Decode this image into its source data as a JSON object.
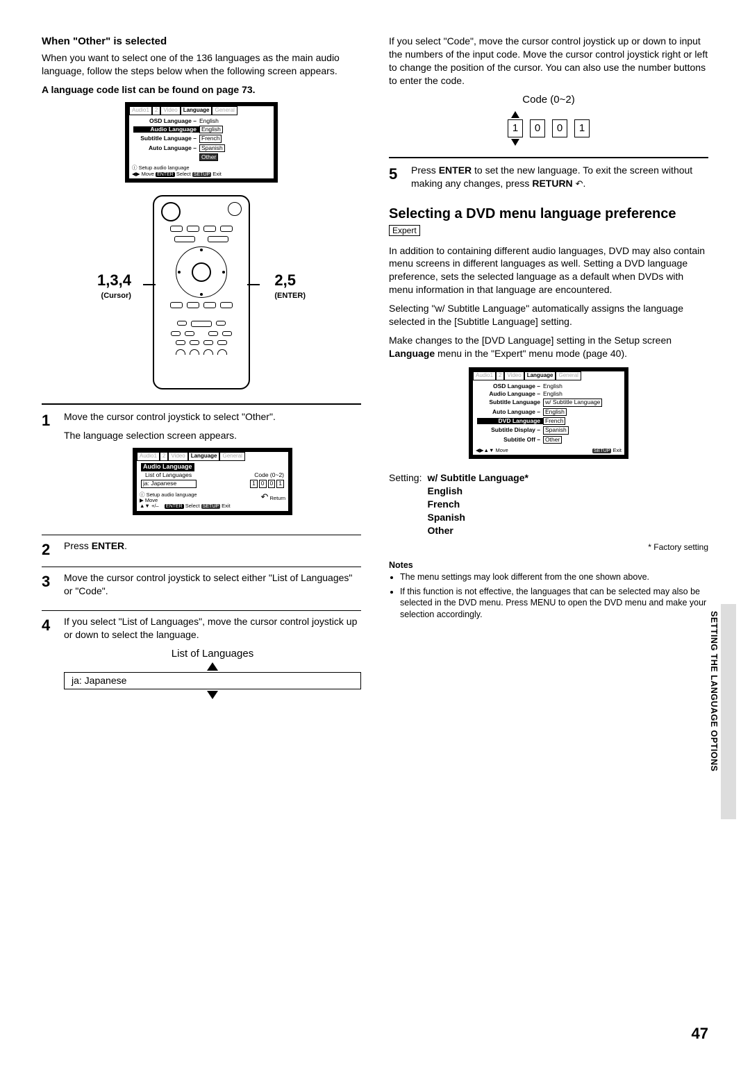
{
  "left": {
    "h_other": "When \"Other\" is selected",
    "p_other": "When you want to select one of the 136 languages as the main audio language, follow the steps below when the following screen appears.",
    "p_codelist": "A language code list can be found on page 73.",
    "screenshot1": {
      "tabs": [
        "Audio1",
        "2",
        "Video",
        "Language",
        "General"
      ],
      "rows": [
        {
          "lbl": "OSD Language –",
          "val": "English"
        },
        {
          "lbl": "Audio Language",
          "val": "English",
          "boxed": true,
          "hl": true
        },
        {
          "lbl": "Subtitle Language –",
          "val": "French",
          "boxed": true
        },
        {
          "lbl": "Auto Language –",
          "val": "Spanish",
          "boxed": true
        },
        {
          "lbl": "",
          "val": "Other",
          "boxed": true,
          "dark": true
        }
      ],
      "hint": "Setup audio language",
      "foot": [
        "Move",
        "ENTER",
        "Select",
        "SETUP",
        "Exit"
      ]
    },
    "callout_left_num": "1,3,4",
    "callout_left_sub": "(Cursor)",
    "callout_right_num": "2,5",
    "callout_right_sub": "(ENTER)",
    "step1_a": "Move the cursor control joystick to select \"Other\".",
    "step1_b": "The language selection screen appears.",
    "screenshot2": {
      "tabs": [
        "Audio1",
        "2",
        "Video",
        "Language",
        "General"
      ],
      "h": "Audio Language",
      "lol": "List of Languages",
      "code": "Code (0~2)",
      "field": "ja: Japanese",
      "digits": [
        "1",
        "0",
        "0",
        "1"
      ],
      "hint": "Setup audio language",
      "foot": [
        "Move",
        "+/–",
        "ENTER",
        "Select",
        "SETUP",
        "Exit",
        "Return"
      ]
    },
    "step2": "Press ",
    "step2_b": "ENTER",
    "step2_c": ".",
    "step3": "Move the cursor control joystick to select either \"List of Languages\" or \"Code\".",
    "step4": "If you select \"List of Languages\", move the cursor control joystick up or down to select the language.",
    "lol_title": "List of Languages",
    "lol_field": "ja: Japanese"
  },
  "right": {
    "p_code": "If you select \"Code\", move the cursor control joystick up or down to input the numbers of the input code. Move the cursor control joystick right or left to change the position of the cursor. You can also use the number buttons to enter the code.",
    "code_title": "Code (0~2)",
    "code_digits": [
      "1",
      "0",
      "0",
      "1"
    ],
    "step5_a": "Press ",
    "step5_b": "ENTER",
    "step5_c": " to set the new language. To exit the screen without making any changes, press ",
    "step5_d": "RETURN",
    "step5_e": " ",
    "h_section_a": "Selecting a DVD menu language preference",
    "expert": "Expert",
    "p_sec1": "In addition to containing different audio languages, DVD may also contain menu screens in different languages as well. Setting a DVD language preference, sets the selected language as a default when DVDs with menu information in that language are encountered.",
    "p_sec2": "Selecting \"w/ Subtitle Language\" automatically assigns the language selected in the [Subtitle Language] setting.",
    "p_sec3_a": "Make changes to the [DVD Language] setting in the Setup screen ",
    "p_sec3_b": "Language",
    "p_sec3_c": " menu in the \"Expert\" menu mode (page 40).",
    "screenshot3": {
      "tabs": [
        "Audio1",
        "2",
        "Video",
        "Language",
        "General"
      ],
      "rows": [
        {
          "lbl": "OSD Language –",
          "val": "English"
        },
        {
          "lbl": "Audio Language –",
          "val": "English"
        },
        {
          "lbl": "Subtitle Language",
          "val": "w/ Subtitle Language",
          "boxed": true
        },
        {
          "lbl": "Auto Language –",
          "val": "English",
          "boxed": true
        },
        {
          "lbl": "DVD Language",
          "val": "French",
          "boxed": true,
          "hl": true
        },
        {
          "lbl": "Subtitle Display –",
          "val": "Spanish",
          "boxed": true
        },
        {
          "lbl": "Subtitle Off –",
          "val": "Other",
          "boxed": true
        }
      ],
      "foot": [
        "Move",
        "SETUP",
        "Exit"
      ]
    },
    "setting_label": "Setting:",
    "setting_vals": [
      "w/ Subtitle Language*",
      "English",
      "French",
      "Spanish",
      "Other"
    ],
    "factory": "* Factory setting",
    "notes_h": "Notes",
    "notes": [
      "The menu settings may look different from the one shown above.",
      "If this function is not effective, the languages that can be selected may also be selected in the DVD menu. Press MENU to open the DVD menu and make your selection accordingly."
    ]
  },
  "side": "SETTING THE LANGUAGE OPTIONS",
  "page": "47"
}
